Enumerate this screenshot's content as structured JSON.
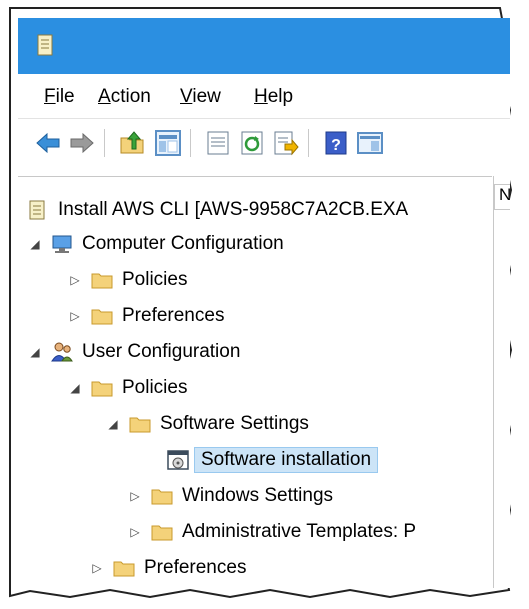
{
  "menu": [
    {
      "label_ul": "F",
      "label_rest": "ile"
    },
    {
      "label_ul": "A",
      "label_rest": "ction"
    },
    {
      "label_ul": "V",
      "label_rest": "iew"
    },
    {
      "label_ul": "H",
      "label_rest": "elp"
    }
  ],
  "toolbar": {
    "icons": [
      "back-icon",
      "forward-icon",
      "up-folder-icon",
      "show-hide-tree-icon",
      "properties-icon",
      "refresh-icon",
      "export-list-icon",
      "help-icon",
      "show-hide-action-pane-icon"
    ]
  },
  "tree": {
    "root_label": "Install AWS CLI [AWS-9958C7A2CB.EXA",
    "computer_config": "Computer Configuration",
    "cc_policies": "Policies",
    "cc_preferences": "Preferences",
    "user_config": "User Configuration",
    "uc_policies": "Policies",
    "software_settings": "Software Settings",
    "software_installation": "Software installation",
    "windows_settings": "Windows Settings",
    "admin_templates": "Administrative Templates: P",
    "uc_preferences": "Preferences"
  },
  "right_pane": {
    "header": "N"
  },
  "colors": {
    "titlebar": "#2b8fe1",
    "selection": "#cce4f7",
    "folder": "#f4d27a"
  }
}
